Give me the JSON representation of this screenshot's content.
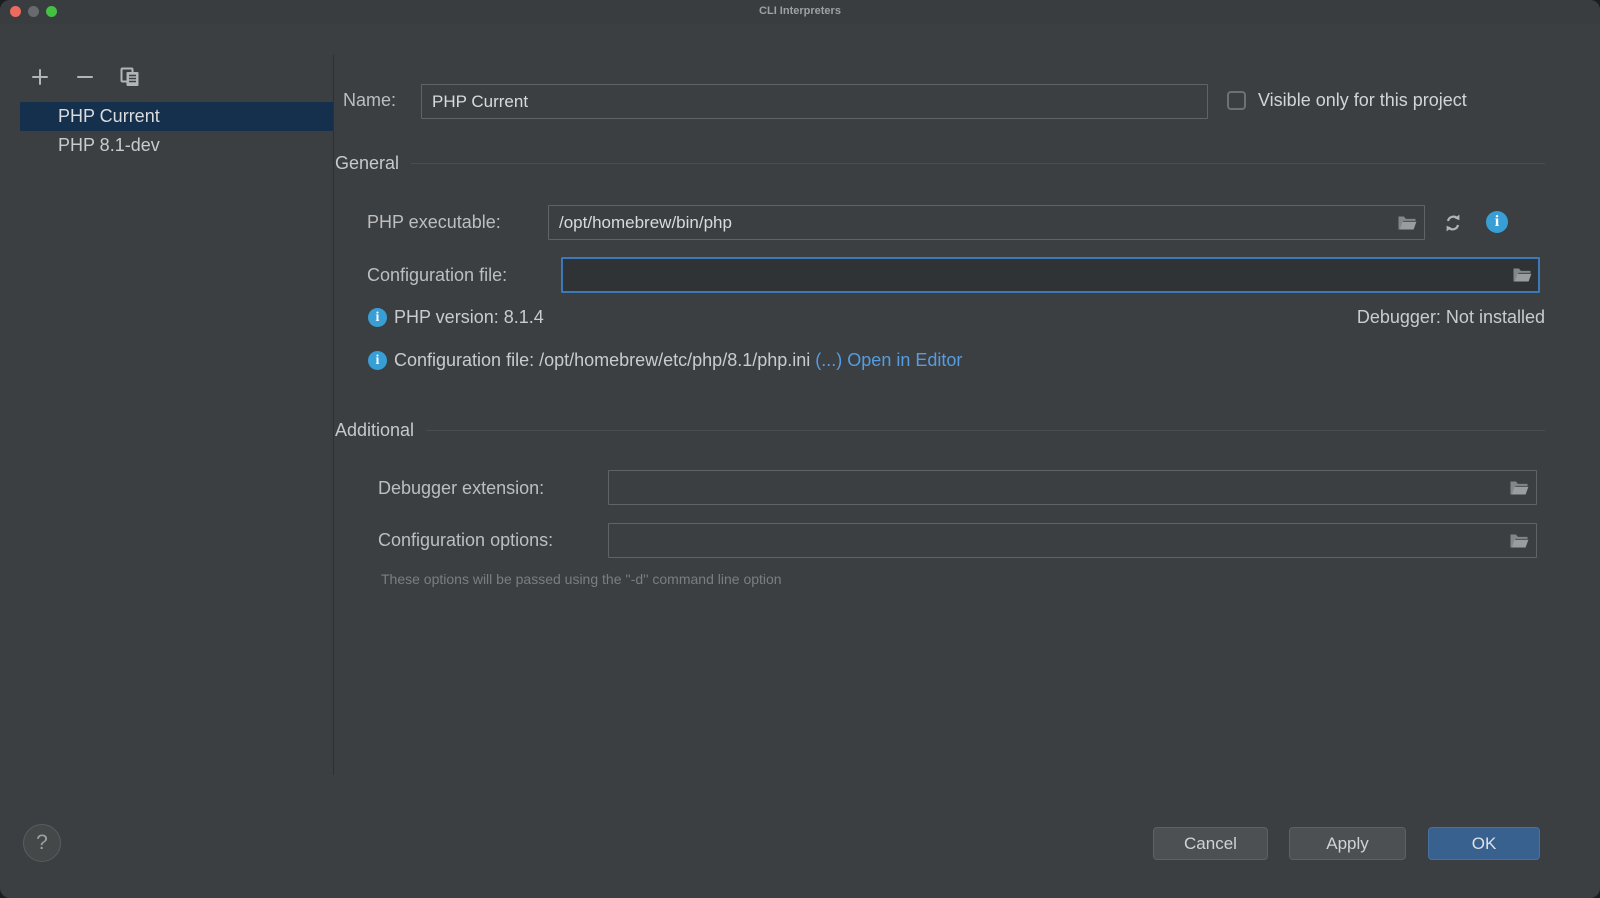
{
  "window": {
    "title": "CLI Interpreters"
  },
  "sidebar": {
    "toolbar": {
      "add": "add-interpreter",
      "remove": "remove-interpreter",
      "copy": "duplicate-interpreter"
    },
    "items": [
      {
        "label": "PHP Current",
        "selected": true
      },
      {
        "label": "PHP 8.1-dev",
        "selected": false
      }
    ]
  },
  "form": {
    "name": {
      "label": "Name:",
      "value": "PHP Current"
    },
    "visible_checkbox": {
      "label": "Visible only for this project",
      "checked": false
    },
    "sections": {
      "general": "General",
      "additional": "Additional"
    },
    "php_executable": {
      "label": "PHP executable:",
      "value": "/opt/homebrew/bin/php"
    },
    "configuration_file": {
      "label": "Configuration file:",
      "value": "",
      "focused": true
    },
    "php_version": {
      "text": "PHP version: 8.1.4"
    },
    "debugger": {
      "text": "Debugger: Not installed"
    },
    "config_info": {
      "text": "Configuration file: /opt/homebrew/etc/php/8.1/php.ini",
      "ellipsis": "(...)",
      "link": "Open in Editor"
    },
    "debugger_extension": {
      "label": "Debugger extension:",
      "value": ""
    },
    "configuration_options": {
      "label": "Configuration options:",
      "value": ""
    },
    "options_hint": "These options will be passed using the ''-d'' command line option"
  },
  "footer": {
    "cancel": "Cancel",
    "apply": "Apply",
    "ok": "OK",
    "help": "?"
  },
  "colors": {
    "dialog_bg": "#3c3f41",
    "selection": "#14304d",
    "focus_border": "#3b79ba",
    "info_icon": "#389fd6",
    "link": "#559ce0",
    "ok_button": "#38618f"
  }
}
